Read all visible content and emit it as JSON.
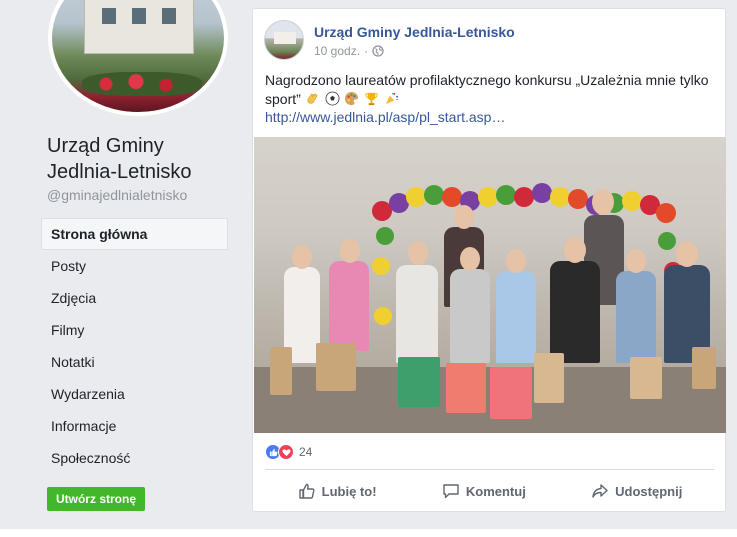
{
  "sidebar": {
    "page_name": "Urząd Gminy Jedlnia-Letnisko",
    "page_handle": "@gminajedlnialetnisko",
    "nav_items": [
      {
        "label": "Strona główna",
        "active": true
      },
      {
        "label": "Posty"
      },
      {
        "label": "Zdjęcia"
      },
      {
        "label": "Filmy"
      },
      {
        "label": "Notatki"
      },
      {
        "label": "Wydarzenia"
      },
      {
        "label": "Informacje"
      },
      {
        "label": "Społeczność"
      }
    ],
    "create_page_label": "Utwórz stronę"
  },
  "post": {
    "author": "Urząd Gminy Jedlnia-Letnisko",
    "time": "10 godz.",
    "visibility_icon": "globe-icon",
    "text": "Nagrodzono laureatów profilaktycznego konkursu „Uzależnia mnie tylko sport”",
    "emojis": [
      "clapping-hands",
      "soccer-ball",
      "palette",
      "trophy",
      "party-popper"
    ],
    "link": "http://www.jedlnia.pl/asp/pl_start.asp…",
    "reactions": {
      "types": [
        "like",
        "love"
      ],
      "count": "24"
    },
    "actions": {
      "like": "Lubię to!",
      "comment": "Komentuj",
      "share": "Udostępnij"
    }
  },
  "colors": {
    "background": "#e9ebee",
    "link_blue": "#365899",
    "create_button_green": "#42b72a",
    "like_blue": "#4a7af5",
    "love_red": "#f0405a"
  }
}
